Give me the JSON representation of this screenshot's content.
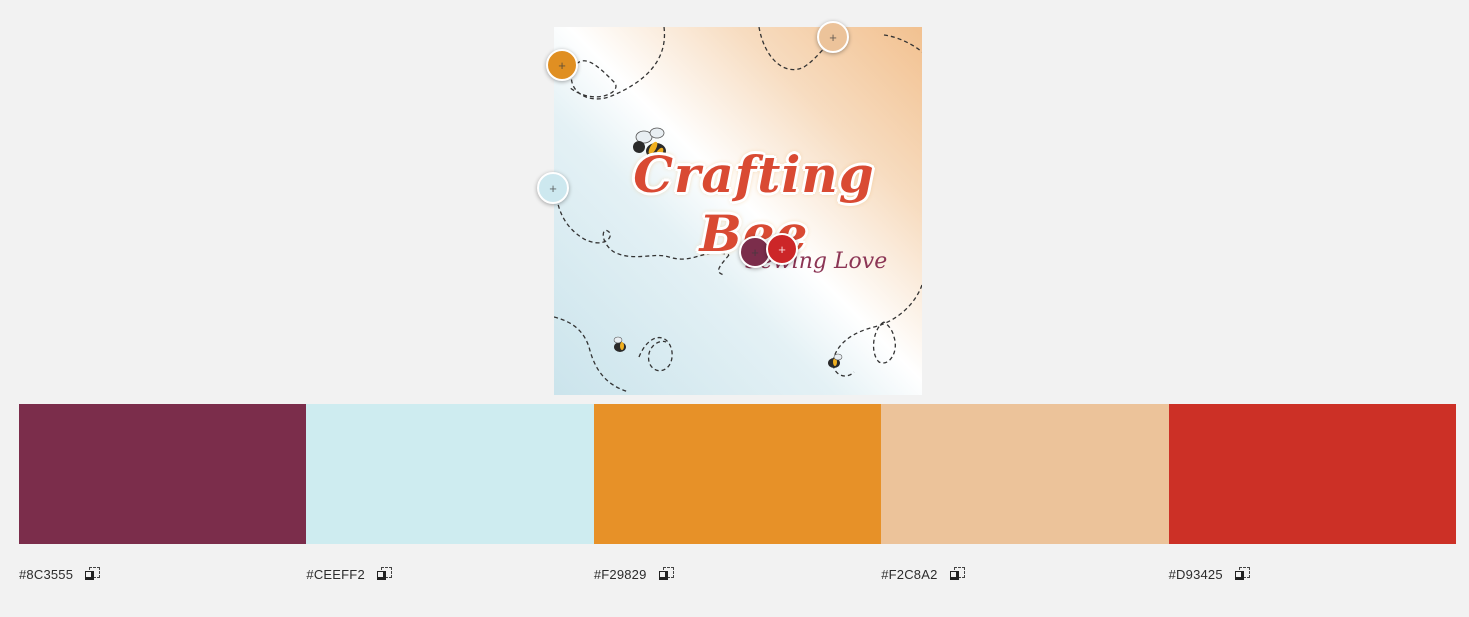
{
  "source_image": {
    "title": "Crafting Bee",
    "subtitle": "Sewing Love"
  },
  "pickers": [
    {
      "name": "picker-orange",
      "color": "#F29829",
      "symbol": "+"
    },
    {
      "name": "picker-peach",
      "color": "#F2C8A2",
      "symbol": "+"
    },
    {
      "name": "picker-light-blue",
      "color": "#CEEFF2",
      "symbol": "+"
    },
    {
      "name": "picker-maroon",
      "color": "#8C3555",
      "symbol": "+"
    },
    {
      "name": "picker-red",
      "color": "#D93425",
      "symbol": "+"
    }
  ],
  "swatches": [
    {
      "hex": "#8C3555",
      "color": "#7b2d4b"
    },
    {
      "hex": "#CEEFF2",
      "color": "#ceecf0"
    },
    {
      "hex": "#F29829",
      "color": "#e79128"
    },
    {
      "hex": "#F2C8A2",
      "color": "#ecc39a"
    },
    {
      "hex": "#D93425",
      "color": "#cc3026"
    }
  ],
  "icons": {
    "copy": "copy-icon",
    "add": "plus-icon"
  }
}
